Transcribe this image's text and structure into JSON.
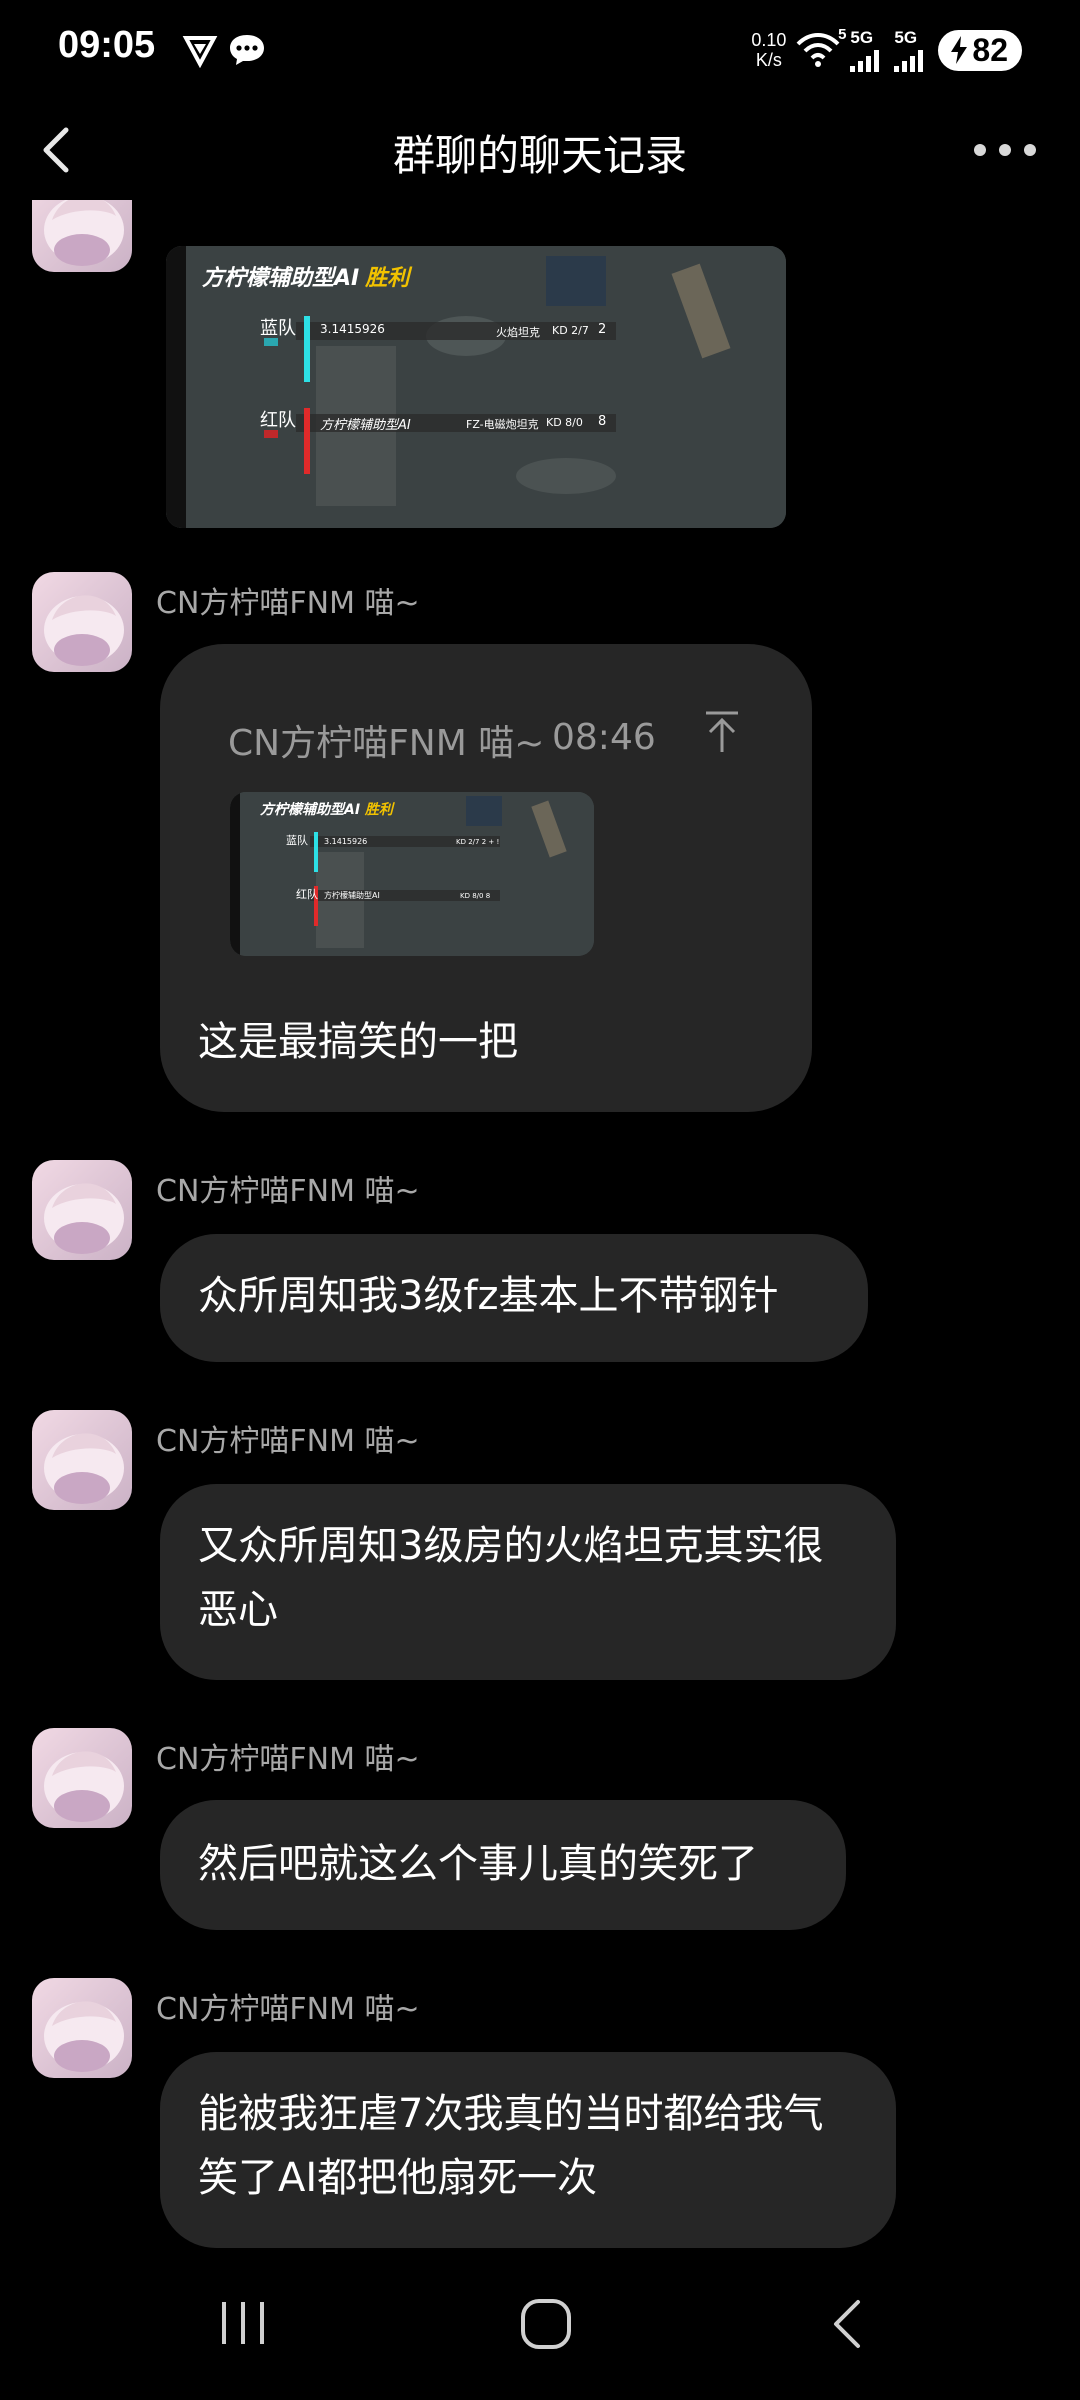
{
  "status_bar": {
    "time": "09:05",
    "net_speed_value": "0.10",
    "net_speed_unit": "K/s",
    "signal1": "5G",
    "signal2": "5G",
    "wifi_badge": "5",
    "battery": "82"
  },
  "header": {
    "title": "群聊的聊天记录",
    "back_icon": "back-chevron-icon",
    "more_icon": "more-dots-icon"
  },
  "game_result": {
    "title": "方柠檬辅助型AI",
    "result": "胜利",
    "blue_team": "蓝队",
    "blue_player": "3.1415926",
    "blue_vehicle": "火焰坦克",
    "blue_kd": "KD 2/7",
    "blue_score": "2",
    "red_team": "红队",
    "red_player": "方柠檬辅助型AI",
    "red_vehicle": "FZ-电磁炮坦克",
    "red_kd": "KD 8/0",
    "red_score": "8"
  },
  "messages": [
    {
      "sender": "CN方柠喵FNM 喵~",
      "quote_sender": "CN方柠喵FNM 喵~",
      "quote_time": "08:46",
      "text": "这是最搞笑的一把"
    },
    {
      "sender": "CN方柠喵FNM 喵~",
      "text": "众所周知我3级fz基本上不带钢针"
    },
    {
      "sender": "CN方柠喵FNM 喵~",
      "text": "又众所周知3级房的火焰坦克其实很恶心"
    },
    {
      "sender": "CN方柠喵FNM 喵~",
      "text": "然后吧就这么个事儿真的笑死了"
    },
    {
      "sender": "CN方柠喵FNM 喵~",
      "text": "能被我狂虐7次我真的当时都给我气笑了AI都把他扇死一次"
    }
  ],
  "navbar": {
    "recent_icon": "recent-apps-icon",
    "home_icon": "home-icon",
    "back_icon": "nav-back-icon"
  }
}
